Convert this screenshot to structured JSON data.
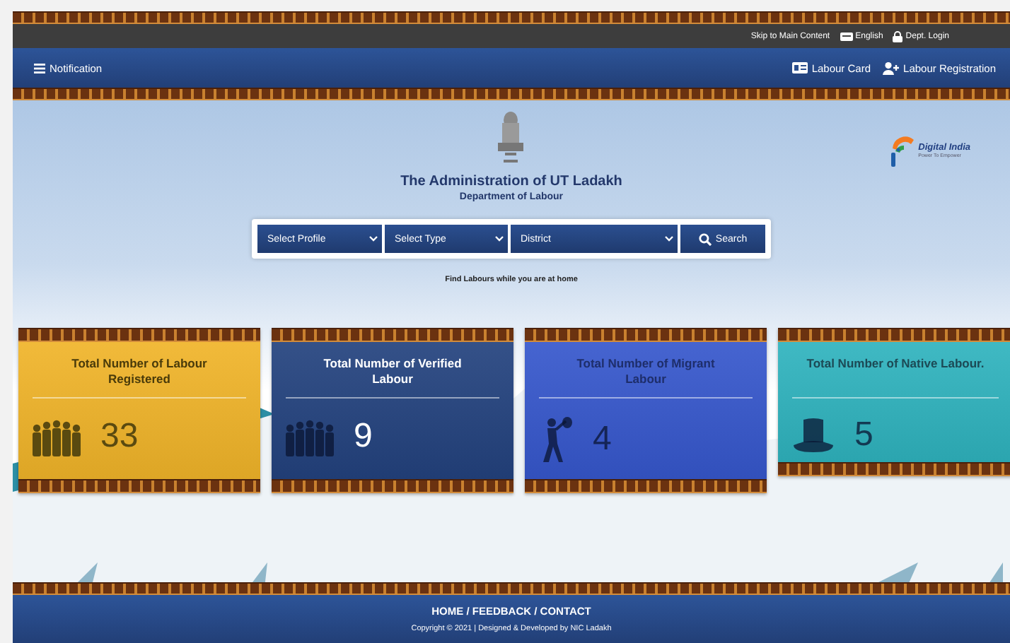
{
  "top_bar": {
    "links": [
      {
        "kind": "text",
        "label": "Skip to Main Content"
      },
      {
        "kind": "language",
        "label": "English"
      },
      {
        "kind": "lock",
        "label": "Dept. Login"
      }
    ]
  },
  "nav": {
    "left": {
      "label": "Notification"
    },
    "right": [
      {
        "kind": "card",
        "label": "Labour Card"
      },
      {
        "kind": "user-add",
        "label": "Labour Registration"
      }
    ]
  },
  "header": {
    "title": "The Administration of UT Ladakh",
    "subtitle": "Department of Labour",
    "logo_text": "Digital India",
    "logo_tagline": "Power To Empower"
  },
  "search": {
    "selects": [
      {
        "label": "Select Profile"
      },
      {
        "label": "Select Type"
      },
      {
        "label": "District"
      }
    ],
    "button": "Search",
    "hint": "Find Labours while you are at home"
  },
  "cards": [
    {
      "title": "Total Number of Labour Registered",
      "value": "33",
      "kind": "group",
      "color": "#f0b429"
    },
    {
      "title": "Total Number of Verified Labour",
      "value": "9",
      "kind": "group",
      "color": "#23427e"
    },
    {
      "title": "Total Number of Migrant Labour",
      "value": "4",
      "kind": "migrant",
      "color": "#3657cc"
    },
    {
      "title": "Total Number of Native Labour.",
      "value": "5",
      "kind": "hat",
      "color": "#2fb3be"
    }
  ],
  "footer": {
    "links": "HOME / FEEDBACK / CONTACT",
    "copyright": "Copyright © 2021 | Designed & Developed by NIC Ladakh"
  }
}
